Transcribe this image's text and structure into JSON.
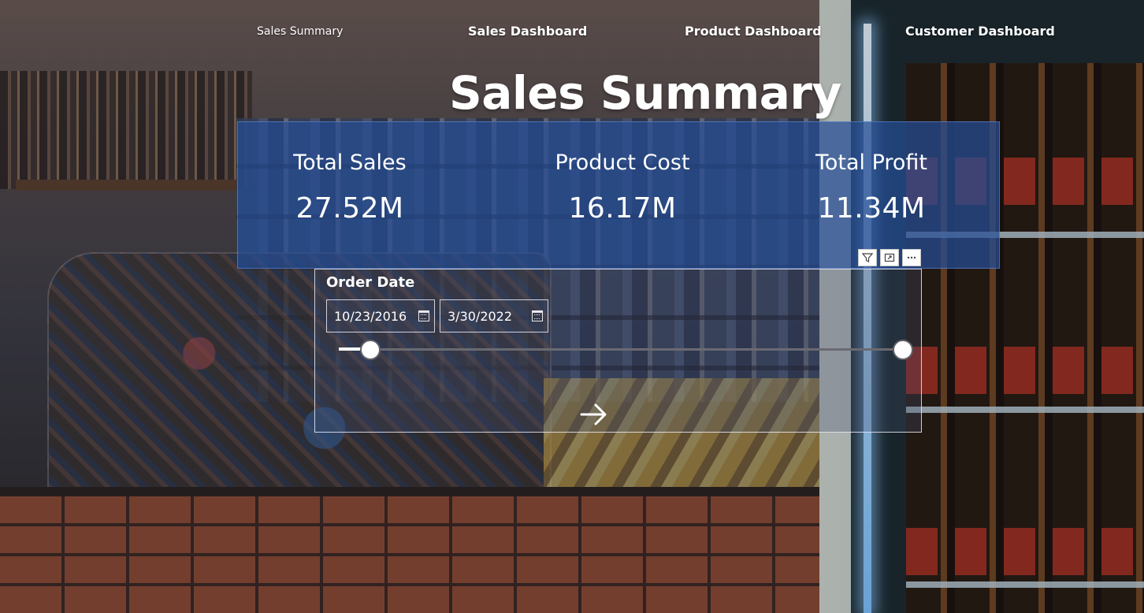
{
  "nav": {
    "items": [
      {
        "label": "Sales Summary"
      },
      {
        "label": "Sales Dashboard"
      },
      {
        "label": "Product Dashboard"
      },
      {
        "label": "Customer Dashboard"
      }
    ]
  },
  "page": {
    "title": "Sales Summary"
  },
  "kpis": [
    {
      "label": "Total Sales",
      "value": "27.52M"
    },
    {
      "label": "Product Cost",
      "value": "16.17M"
    },
    {
      "label": "Total Profit",
      "value": "11.34M"
    }
  ],
  "card_tools": [
    {
      "icon": "filter-icon"
    },
    {
      "icon": "focus-mode-icon"
    },
    {
      "icon": "more-options-icon"
    }
  ],
  "slicer": {
    "title": "Order Date",
    "start_date": "10/23/2016",
    "end_date": "3/30/2022",
    "range_fraction": [
      0.06,
      1.0
    ]
  },
  "colors": {
    "card_background": "#264e96",
    "text": "#ffffff",
    "slider_track": "#6a6a72"
  }
}
